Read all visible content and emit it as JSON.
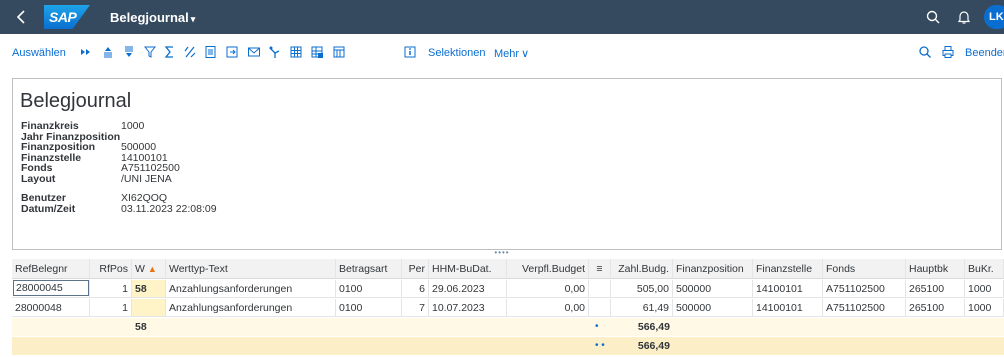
{
  "shell": {
    "back_glyph": "<",
    "logo_text": "SAP",
    "app_title": "Belegjournal",
    "title_caret": "▾",
    "user_initials": "LK",
    "icons": [
      "search-icon",
      "bell-icon"
    ]
  },
  "toolbar": {
    "auswaehlen": "Auswählen",
    "selektionen": "Selektionen",
    "mehr": "Mehr",
    "mehr_caret": "∨",
    "beenden": "Beender",
    "icons": [
      "fast-entry-icon",
      "sort-ascending-icon",
      "sort-descending-icon",
      "filter-icon",
      "sum-icon",
      "subtotal-icon",
      "print-preview-icon",
      "export-icon",
      "mail-icon",
      "graphic-icon",
      "abc-analysis-icon",
      "spreadsheet-icon",
      "layout-icon",
      "info-icon",
      "find-icon",
      "print-icon"
    ]
  },
  "header": {
    "title": "Belegjournal",
    "rows": [
      {
        "label": "Finanzkreis",
        "value": "1000"
      },
      {
        "label": "Jahr Finanzposition",
        "value": ""
      },
      {
        "label": "Finanzposition",
        "value": "500000"
      },
      {
        "label": "Finanzstelle",
        "value": "14100101"
      },
      {
        "label": "Fonds",
        "value": "A751102500"
      },
      {
        "label": "Layout",
        "value": "/UNI JENA"
      },
      {
        "label": "",
        "value": ""
      },
      {
        "label": "Benutzer",
        "value": "XI62QOQ"
      },
      {
        "label": "Datum/Zeit",
        "value": "03.11.2023 22:08:09"
      }
    ]
  },
  "table": {
    "columns": [
      "RefBelegnr",
      "RfPos",
      "W",
      "Werttyp-Text",
      "Betragsart",
      "Per",
      "HHM-BuDat.",
      "Verpfl.Budget",
      "≡",
      "Zahl.Budg.",
      "Finanzposition",
      "Finanzstelle",
      "Fonds",
      "Hauptbk",
      "BuKr."
    ],
    "sort_marker": "▲",
    "rows": [
      [
        "28000045",
        "1",
        "58",
        "Anzahlungsanforderungen",
        "0100",
        "6",
        "29.06.2023",
        "0,00",
        "",
        "505,00",
        "500000",
        "14100101",
        "A751102500",
        "265100",
        "1000"
      ],
      [
        "28000048",
        "1",
        "",
        "Anzahlungsanforderungen",
        "0100",
        "7",
        "10.07.2023",
        "0,00",
        "",
        "61,49",
        "500000",
        "14100101",
        "A751102500",
        "265100",
        "1000"
      ]
    ],
    "subtotal": {
      "w": "58",
      "marker": "•",
      "amount": "566,49"
    },
    "total": {
      "marker": "• •",
      "amount": "566,49"
    }
  }
}
